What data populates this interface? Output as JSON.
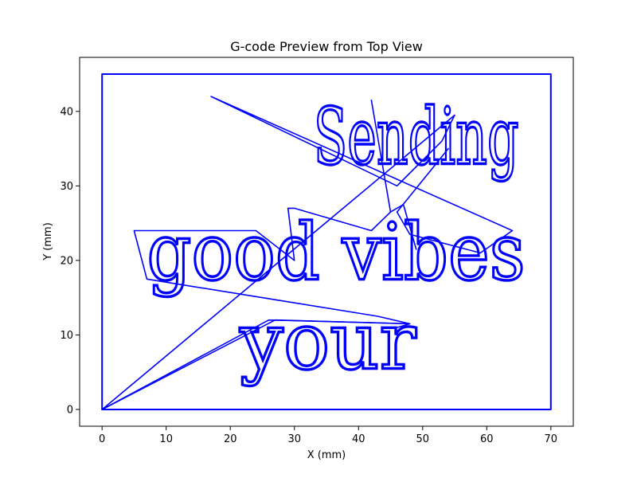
{
  "chart_data": {
    "type": "line",
    "title": "G-code Preview from Top View",
    "xlabel": "X (mm)",
    "ylabel": "Y (mm)",
    "xlim": [
      -3.5,
      73.5
    ],
    "ylim": [
      -2.25,
      47.25
    ],
    "xticks": [
      0,
      10,
      20,
      30,
      40,
      50,
      60,
      70
    ],
    "yticks": [
      0,
      10,
      20,
      30,
      40
    ],
    "grid": false,
    "legend": "none",
    "line_color": "#0000ff",
    "text_lines": [
      {
        "text": "Sending",
        "baseline_y": 33.0
      },
      {
        "text": "good vibes",
        "baseline_y": 17.5
      },
      {
        "text": "your",
        "baseline_y": 5.5
      }
    ],
    "series": [
      {
        "x": [
          0,
          0,
          70,
          70,
          0
        ],
        "y": [
          0,
          45,
          45,
          0,
          0
        ]
      },
      {
        "x": [
          0,
          55,
          53,
          46,
          17,
          64,
          59,
          48,
          46,
          54
        ],
        "y": [
          0,
          39.5,
          36,
          30,
          42,
          24,
          21,
          23.5,
          26.5,
          35
        ]
      },
      {
        "x": [
          0,
          26,
          48,
          43,
          7,
          5,
          24,
          30,
          29,
          30,
          42,
          45
        ],
        "y": [
          0,
          12,
          11.5,
          12.5,
          17.5,
          24,
          24,
          20,
          27,
          27,
          24,
          26.5
        ]
      },
      {
        "x": [
          0,
          27,
          48,
          46
        ],
        "y": [
          0,
          12,
          11.5,
          11
        ]
      },
      {
        "x": [
          42,
          45,
          47,
          49
        ],
        "y": [
          41.5,
          26.5,
          27.5,
          21.5
        ]
      }
    ]
  }
}
